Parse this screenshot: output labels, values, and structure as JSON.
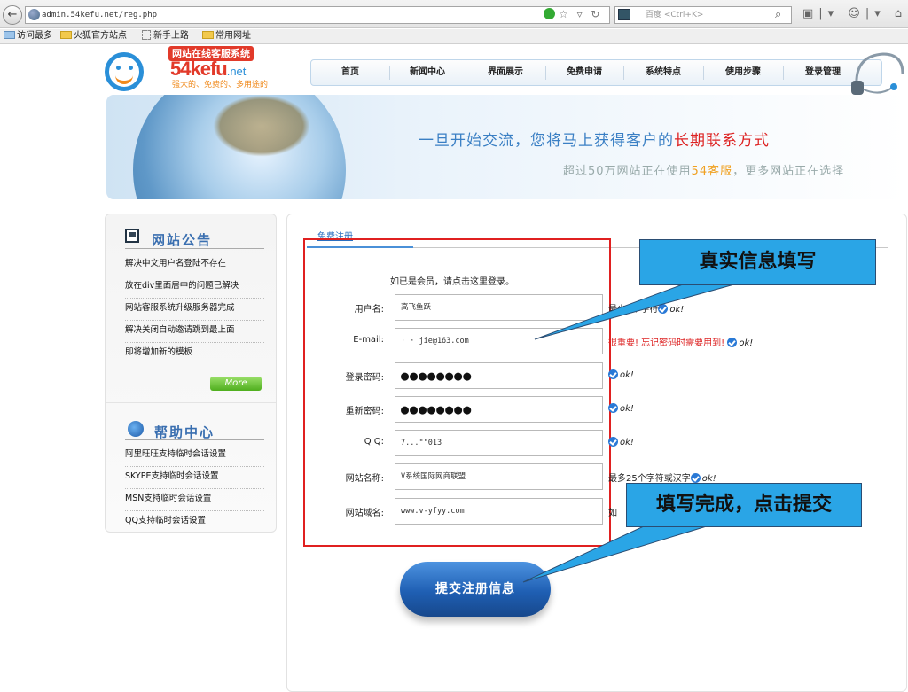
{
  "browser": {
    "url": "admin.54kefu.net/reg.php",
    "search_placeholder": "百度 <Ctrl+K>",
    "bookmarks": [
      "访问最多",
      "火狐官方站点",
      "新手上路",
      "常用网址"
    ]
  },
  "logo": {
    "banner": "网站在线客服系统",
    "brand": "54kefu",
    "brand_suffix": ".net",
    "slogan": "强大的、免费的、多用途的"
  },
  "nav": {
    "items": [
      "首页",
      "新闻中心",
      "界面展示",
      "免费申请",
      "系统特点",
      "使用步骤",
      "登录管理"
    ]
  },
  "banner": {
    "line1_a": "一旦开始交流，您将马上获得客户的",
    "line1_b": "长期联系方式",
    "line2_a": "超过50万网站正在使用",
    "line2_b": "54客服",
    "line2_c": "，更多网站正在选择"
  },
  "sidebar": {
    "notice_title": "网站公告",
    "notices": [
      "解决中文用户名登陆不存在",
      "放在div里面居中的问题已解决",
      "网站客服系统升级服务器完成",
      "解决关闭自动邀请跳到最上面",
      "即将增加新的模板"
    ],
    "more_label": "More",
    "help_title": "帮助中心",
    "help_links": [
      "阿里旺旺支持临时会话设置",
      "SKYPE支持临时会话设置",
      "MSN支持临时会话设置",
      "QQ支持临时会话设置"
    ]
  },
  "form": {
    "tab_label": "免费注册",
    "login_hint": "如已是会员，请点击这里登录。",
    "fields": [
      {
        "label": "用户名:",
        "value": "高飞鱼跃",
        "hint": "最少4个字符",
        "ok": "ok!"
      },
      {
        "label": "E-mail:",
        "value": "·        ·  jie@163.com",
        "hint": "很重要! 忘记密码时需要用到!",
        "ok": "ok!"
      },
      {
        "label": "登录密码:",
        "value": "●●●●●●●●",
        "hint": "",
        "ok": "ok!"
      },
      {
        "label": "重新密码:",
        "value": "●●●●●●●●",
        "hint": "",
        "ok": "ok!"
      },
      {
        "label": "Q Q:",
        "value": "7...\"\"013",
        "hint": "",
        "ok": "ok!"
      },
      {
        "label": "网站名称:",
        "value": "V系统国际网商联盟",
        "hint": "最多25个字符或汉字",
        "ok": "ok!"
      },
      {
        "label": "网站域名:",
        "value": "www.v-yfyy.com",
        "hint": "如",
        "ok": ""
      }
    ],
    "submit_label": "提交注册信息"
  },
  "callouts": {
    "top": "真实信息填写",
    "bottom": "填写完成，点击提交"
  },
  "colors": {
    "accent_blue": "#2a8fd8",
    "frame_red": "#e02020",
    "callout_blue": "#2aa5e6"
  }
}
